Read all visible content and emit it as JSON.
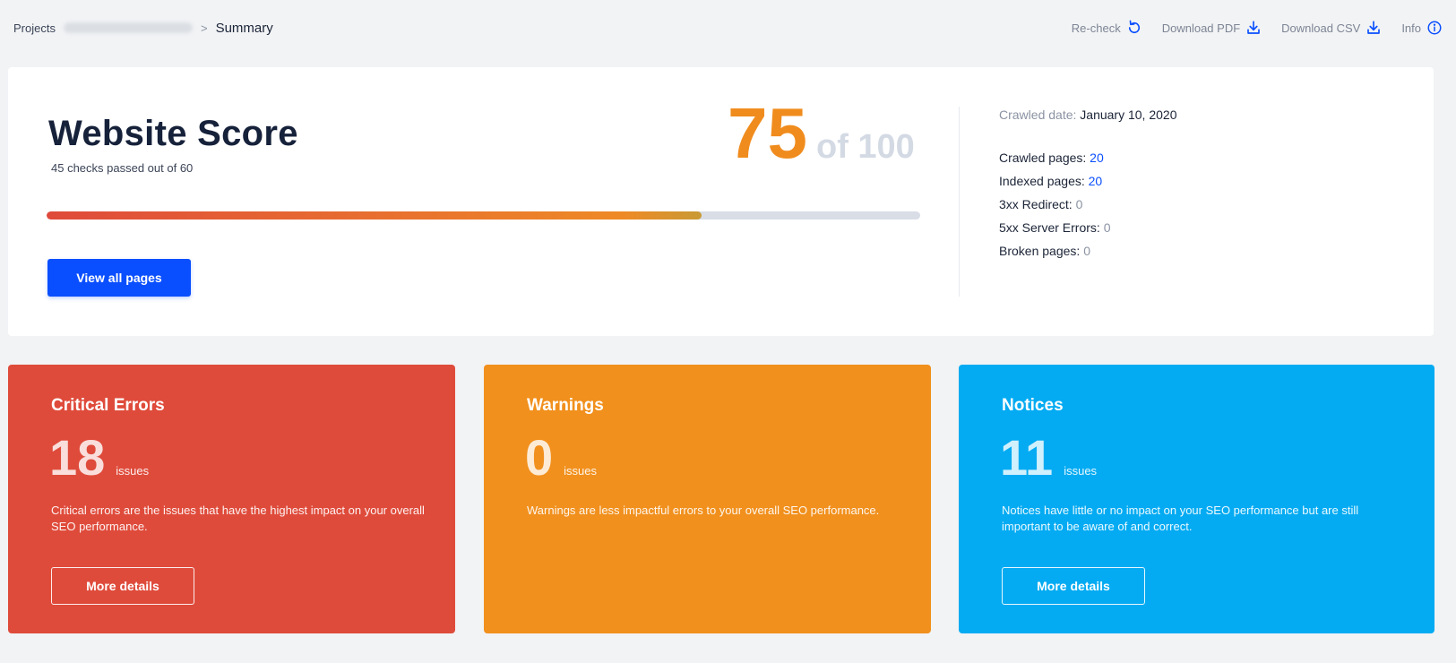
{
  "breadcrumb": {
    "root": "Projects",
    "separator": ">",
    "current": "Summary"
  },
  "actions": [
    {
      "label": "Re-check",
      "icon": "refresh-icon"
    },
    {
      "label": "Download PDF",
      "icon": "download-icon"
    },
    {
      "label": "Download CSV",
      "icon": "download-icon"
    },
    {
      "label": "Info",
      "icon": "info-icon"
    }
  ],
  "score": {
    "title": "Website Score",
    "subtitle": "45 checks passed out of 60",
    "value": "75",
    "of": "of 100",
    "progress_fraction": 0.75,
    "button_label": "View all pages"
  },
  "crawl": {
    "date_label": "Crawled date:",
    "date_value": "January 10, 2020",
    "stats": [
      {
        "label": "Crawled pages:",
        "value": "20",
        "link": true
      },
      {
        "label": "Indexed pages:",
        "value": "20",
        "link": true
      },
      {
        "label": "3xx Redirect:",
        "value": "0",
        "link": false
      },
      {
        "label": "5xx Server Errors:",
        "value": "0",
        "link": false
      },
      {
        "label": "Broken pages:",
        "value": "0",
        "link": false
      }
    ]
  },
  "issues": {
    "errors": {
      "title": "Critical Errors",
      "count": "18",
      "unit": "issues",
      "description": "Critical errors are the issues that have the highest impact on your overall SEO performance.",
      "button_label": "More details"
    },
    "warnings": {
      "title": "Warnings",
      "count": "0",
      "unit": "issues",
      "description": "Warnings are less impactful errors to your overall SEO performance."
    },
    "notices": {
      "title": "Notices",
      "count": "11",
      "unit": "issues",
      "description": "Notices have little or no impact on your SEO performance but are still important to be aware of and correct.",
      "button_label": "More details"
    }
  },
  "colors": {
    "accent": "#0a4fff",
    "error": "#df4b3b",
    "warning": "#f1901d",
    "notice": "#04abf2",
    "score": "#f08c1d"
  }
}
